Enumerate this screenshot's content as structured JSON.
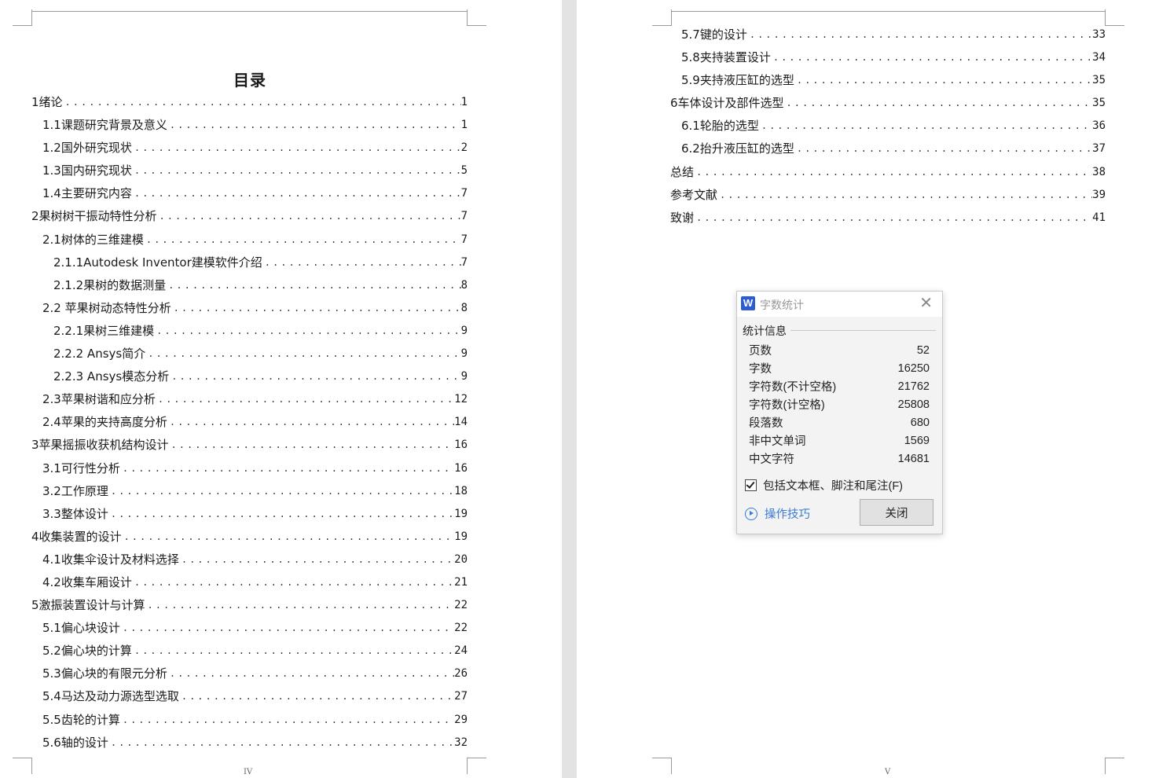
{
  "left_page": {
    "title": "目录",
    "footer": "IV",
    "entries": [
      {
        "label": "1绪论",
        "page": "1",
        "level": 1
      },
      {
        "label": "1.1课题研究背景及意义",
        "page": "1",
        "level": 2
      },
      {
        "label": "1.2国外研究现状",
        "page": "2",
        "level": 2
      },
      {
        "label": "1.3国内研究现状",
        "page": "5",
        "level": 2
      },
      {
        "label": "1.4主要研究内容",
        "page": "7",
        "level": 2
      },
      {
        "label": "2果树树干振动特性分析",
        "page": "7",
        "level": 1
      },
      {
        "label": "2.1树体的三维建模",
        "page": "7",
        "level": 2
      },
      {
        "label": "2.1.1Autodesk Inventor建模软件介绍",
        "page": "7",
        "level": 3
      },
      {
        "label": "2.1.2果树的数据测量",
        "page": "8",
        "level": 3
      },
      {
        "label": "2.2 苹果树动态特性分析",
        "page": "8",
        "level": 2
      },
      {
        "label": "2.2.1果树三维建模",
        "page": "9",
        "level": 3
      },
      {
        "label": "2.2.2 Ansys简介",
        "page": "9",
        "level": 3
      },
      {
        "label": "2.2.3 Ansys模态分析",
        "page": "9",
        "level": 3
      },
      {
        "label": "2.3苹果树谐和应分析",
        "page": "12",
        "level": 2
      },
      {
        "label": "2.4苹果的夹持高度分析",
        "page": "14",
        "level": 2
      },
      {
        "label": "3苹果摇振收获机结构设计",
        "page": "16",
        "level": 1
      },
      {
        "label": "3.1可行性分析",
        "page": "16",
        "level": 2
      },
      {
        "label": "3.2工作原理",
        "page": "18",
        "level": 2
      },
      {
        "label": "3.3整体设计",
        "page": "19",
        "level": 2
      },
      {
        "label": "4收集装置的设计",
        "page": "19",
        "level": 1
      },
      {
        "label": "4.1收集伞设计及材料选择",
        "page": "20",
        "level": 2
      },
      {
        "label": "4.2收集车厢设计",
        "page": "21",
        "level": 2
      },
      {
        "label": "5激振装置设计与计算",
        "page": "22",
        "level": 1
      },
      {
        "label": "5.1偏心块设计",
        "page": "22",
        "level": 2
      },
      {
        "label": "5.2偏心块的计算",
        "page": "24",
        "level": 2
      },
      {
        "label": "5.3偏心块的有限元分析",
        "page": "26",
        "level": 2
      },
      {
        "label": "5.4马达及动力源选型选取",
        "page": "27",
        "level": 2
      },
      {
        "label": "5.5齿轮的计算",
        "page": "29",
        "level": 2
      },
      {
        "label": "5.6轴的设计",
        "page": "32",
        "level": 2
      }
    ]
  },
  "right_page": {
    "footer": "V",
    "entries": [
      {
        "label": "5.7键的设计",
        "page": "33",
        "level": 2
      },
      {
        "label": "5.8夹持装置设计",
        "page": "34",
        "level": 2
      },
      {
        "label": "5.9夹持液压缸的选型",
        "page": "35",
        "level": 2
      },
      {
        "label": "6车体设计及部件选型",
        "page": "35",
        "level": 1
      },
      {
        "label": "6.1轮胎的选型",
        "page": "36",
        "level": 2
      },
      {
        "label": "6.2抬升液压缸的选型",
        "page": "37",
        "level": 2
      },
      {
        "label": "总结",
        "page": "38",
        "level": 1
      },
      {
        "label": "参考文献",
        "page": "39",
        "level": 1
      },
      {
        "label": "致谢",
        "page": "41",
        "level": 1
      }
    ]
  },
  "dialog": {
    "app_icon_letter": "W",
    "title": "字数统计",
    "section_label": "统计信息",
    "stats": [
      {
        "label": "页数",
        "value": "52"
      },
      {
        "label": "字数",
        "value": "16250"
      },
      {
        "label": "字符数(不计空格)",
        "value": "21762"
      },
      {
        "label": "字符数(计空格)",
        "value": "25808"
      },
      {
        "label": "段落数",
        "value": "680"
      },
      {
        "label": "非中文单词",
        "value": "1569"
      },
      {
        "label": "中文字符",
        "value": "14681"
      }
    ],
    "checkbox_label": "包括文本框、脚注和尾注(F)",
    "checkbox_checked": true,
    "tips_label": "操作技巧",
    "close_label": "关闭"
  }
}
